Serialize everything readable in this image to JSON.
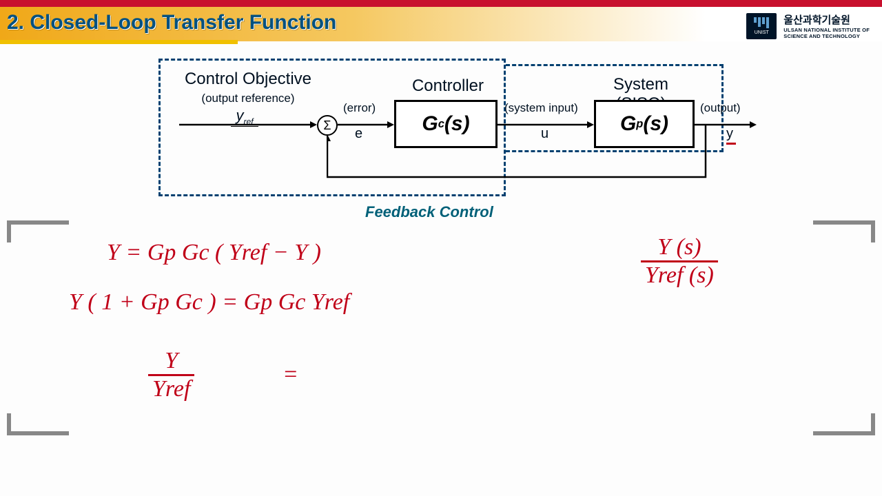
{
  "header": {
    "title": "2. Closed-Loop Transfer Function",
    "logo_kr": "울산과학기술원",
    "logo_en1": "ULSAN NATIONAL INSTITUTE OF",
    "logo_en2": "SCIENCE AND TECHNOLOGY",
    "logo_mark": "UNIST"
  },
  "diagram": {
    "control_objective": "Control Objective",
    "output_reference": "(output reference)",
    "yref": "y",
    "yref_sub": "ref",
    "error": "(error)",
    "e": "e",
    "sum": "Σ",
    "controller": "Controller",
    "gc": "G",
    "gc_sub": "c",
    "gc_s": "(s)",
    "system_input": "(system input)",
    "u": "u",
    "system": "System (SISO)",
    "gp": "G",
    "gp_sub": "p",
    "gp_s": "(s)",
    "output": "(output)",
    "y": "y",
    "feedback": "Feedback Control"
  },
  "hand": {
    "eq1": "Y  =  Gp Gc ( Yref − Y )",
    "eq2": "Y ( 1 + Gp Gc )  =  Gp Gc Yref",
    "eq3_num": "Y",
    "eq3_den": "Yref",
    "eq3_eq": "=",
    "rhs_num": "Y (s)",
    "rhs_den": "Yref (s)"
  }
}
